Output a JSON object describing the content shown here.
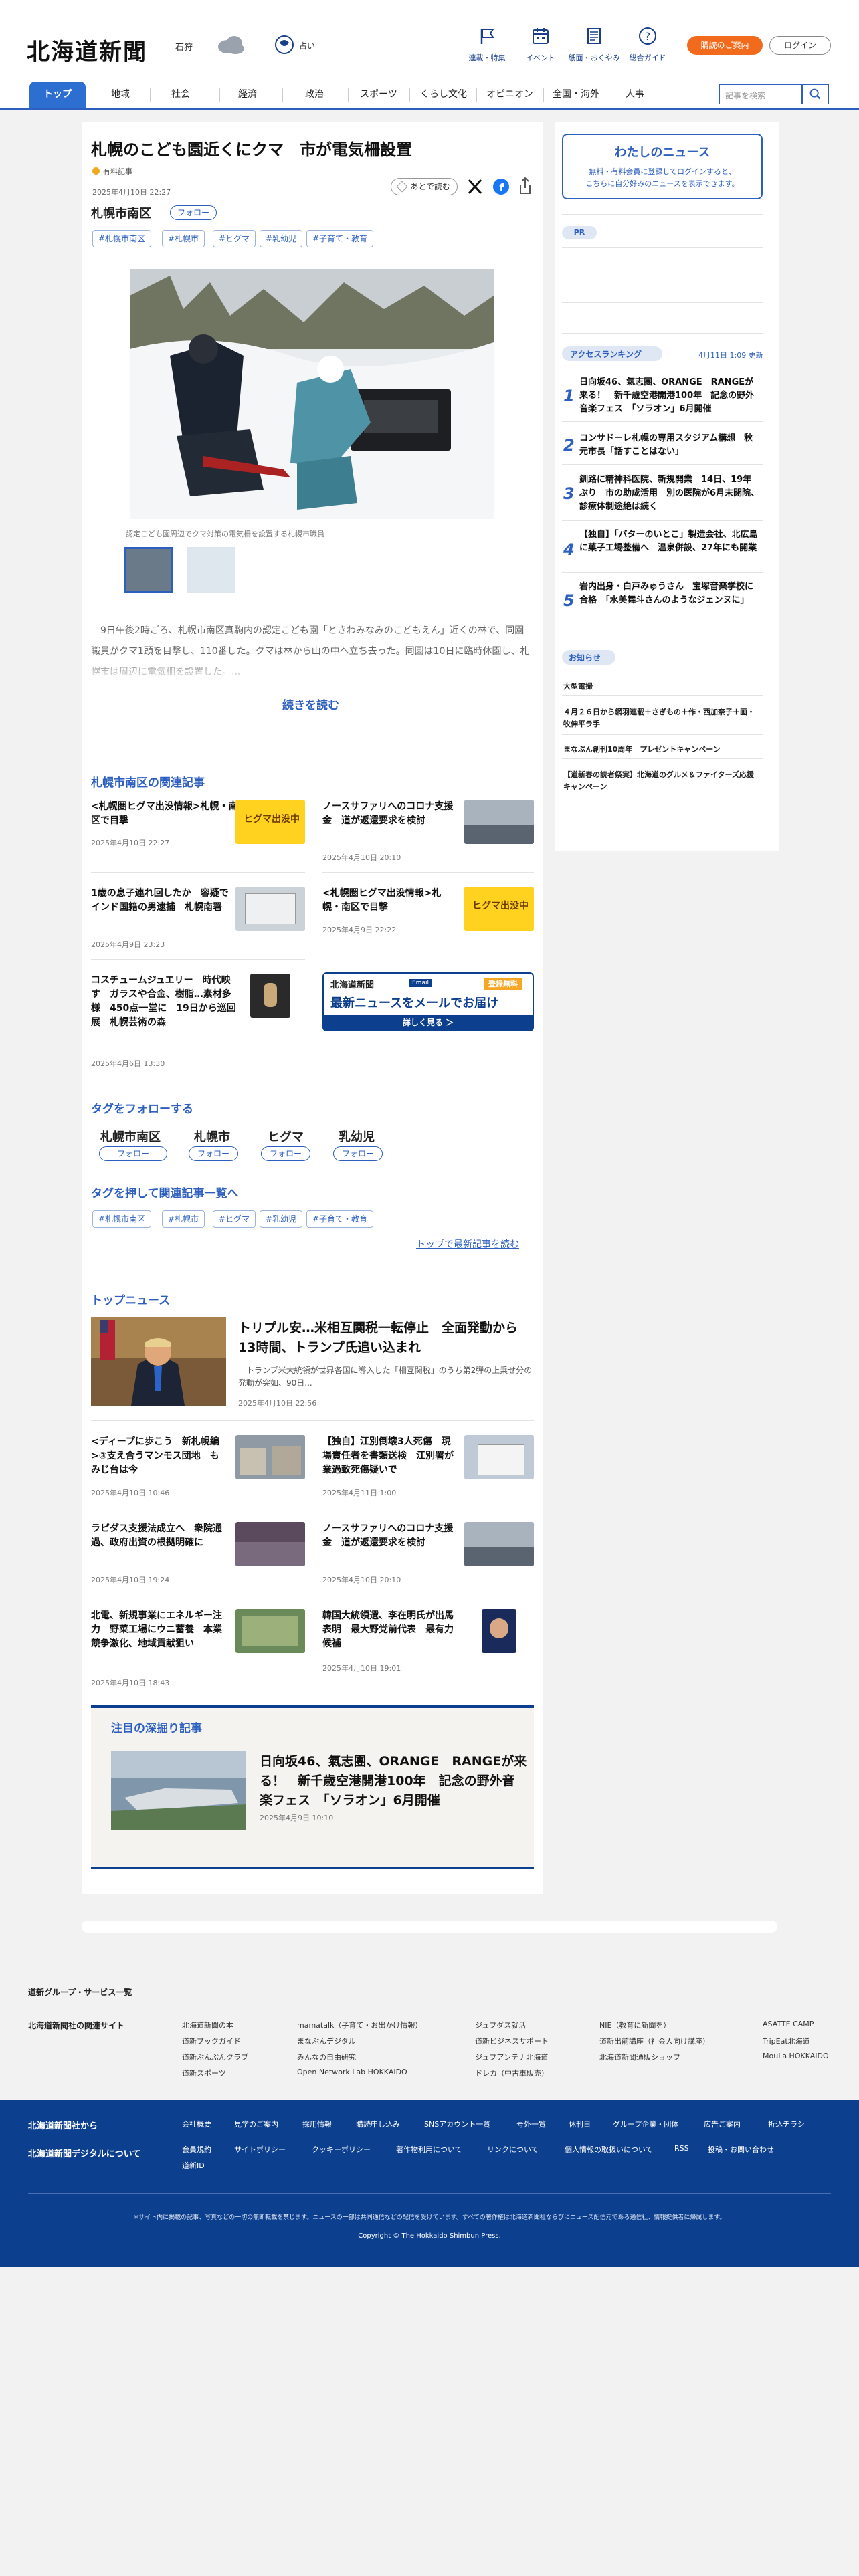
{
  "header": {
    "logo": "北海道新聞",
    "location": "石狩",
    "lang_label": "占い",
    "nav": [
      {
        "label": "連載・特集"
      },
      {
        "label": "イベント"
      },
      {
        "label": "紙面・おくやみ"
      },
      {
        "label": "総合ガイド"
      }
    ],
    "subscribe_label": "購読のご案内",
    "login_label": "ログイン"
  },
  "categories": [
    "トップ",
    "地域",
    "社会",
    "経済",
    "政治",
    "スポーツ",
    "くらし文化",
    "オピニオン",
    "全国・海外",
    "人事"
  ],
  "search": {
    "placeholder": "記事を検索"
  },
  "article": {
    "title": "札幌のこども園近くにクマ　市が電気柵設置",
    "badge": "有料記事",
    "date": "2025年4月10日 22:27",
    "save_label": "あとで読む",
    "area": "札幌市南区",
    "follow_label": "フォロー",
    "tags": [
      "#札幌市南区",
      "#札幌市",
      "#ヒグマ",
      "#乳幼児",
      "#子育て・教育"
    ],
    "caption": "認定こども園周辺でクマ対策の電気柵を設置する札幌市職員",
    "body": "　9日午後2時ごろ、札幌市南区真駒内の認定こども園「ときわみなみのこどもえん」近くの林で、同園職員がクマ1頭を目撃し、110番した。クマは林から山の中へ立ち去った。同園は10日に臨時休園し、札幌市は周辺に電気柵を設置した。...",
    "read_more": "続きを読む"
  },
  "related": {
    "heading": "札幌市南区の関連記事",
    "items": [
      {
        "title": "<札幌圏ヒグマ出没情報>札幌・南区で目撃",
        "date": "2025年4月10日 22:27",
        "thumb_text": "ヒグマ出没中"
      },
      {
        "title": "ノースサファリへのコロナ支援金　道が返還要求を検討",
        "date": "2025年4月10日 20:10",
        "thumb_text": ""
      },
      {
        "title": "1歳の息子連れ回したか　容疑でインド国籍の男逮捕　札幌南署",
        "date": "2025年4月9日 23:23",
        "thumb_text": ""
      },
      {
        "title": "<札幌圏ヒグマ出没情報>札幌・南区で目撃",
        "date": "2025年4月9日 22:22",
        "thumb_text": "ヒグマ出没中"
      },
      {
        "title": "コスチュームジュエリー　時代映す　ガラスや合金、樹脂…素材多様　450点一堂に　19日から巡回展　札幌芸術の森",
        "date": "2025年4月6日 13:30",
        "thumb_text": ""
      }
    ],
    "mail_ad": {
      "logo": "北海道新聞",
      "badge_left": "Email",
      "badge_right": "登録無料",
      "headline": "最新ニュースをメールでお届け",
      "sub": "詳しく見る ＞"
    }
  },
  "follow_tags": {
    "heading": "タグをフォローする",
    "items": [
      "札幌市南区",
      "札幌市",
      "ヒグマ",
      "乳幼児"
    ],
    "button_label": "フォロー"
  },
  "press_tags": {
    "heading": "タグを押して関連記事一覧へ",
    "items": [
      "#札幌市南区",
      "#札幌市",
      "#ヒグマ",
      "#乳幼児",
      "#子育て・教育"
    ],
    "top_link": "トップで最新記事を読む"
  },
  "top_news": {
    "heading": "トップニュース",
    "lead": {
      "title": "トリプル安…米相互関税一転停止　全面発動から13時間、トランプ氏追い込まれ",
      "summary": "　トランプ米大統領が世界各国に導入した「相互関税」のうち第2弾の上乗せ分の発動が突如、90日...",
      "date": "2025年4月10日 22:56"
    },
    "items": [
      {
        "title": "<ディープに歩こう　新札幌編>③支え合うマンモス団地　もみじ台は今",
        "date": "2025年4月10日 10:46"
      },
      {
        "title": "【独自】江別倒壊3人死傷　現場責任者を書類送検　江別署が業過致死傷疑いで",
        "date": "2025年4月11日 1:00"
      },
      {
        "title": "ラピダス支援法成立へ　衆院通過、政府出資の根拠明確に",
        "date": "2025年4月10日 19:24"
      },
      {
        "title": "ノースサファリへのコロナ支援金　道が返還要求を検討",
        "date": "2025年4月10日 20:10"
      },
      {
        "title": "北電、新規事業にエネルギー注力　野菜工場にウニ蓄養　本業競争激化、地域貢献狙い",
        "date": "2025年4月10日 18:43"
      },
      {
        "title": "韓国大統領選、李在明氏が出馬表明　最大野党前代表　最有力候補",
        "date": "2025年4月10日 19:01"
      }
    ]
  },
  "deep": {
    "heading": "注目の深掘り記事",
    "title": "日向坂46、氣志團、ORANGE　RANGEが来る！　新千歳空港開港100年　記念の野外音楽フェス　「ソラオン」6月開催",
    "date": "2025年4月9日 10:10"
  },
  "sidebar": {
    "my_news_title": "わたしのニュース",
    "my_news_text_1": "無料・有料会員に登録して",
    "my_news_login": "ログイン",
    "my_news_text_2": "すると、",
    "my_news_text_3": "こちらに自分好みのニュースを表示できます。",
    "pr_label": "PR",
    "ranking_label": "アクセスランキング",
    "ranking_time": "4月11日 1:09 更新",
    "ranking": [
      {
        "rank": "1",
        "title": "日向坂46、氣志團、ORANGE　RANGEが来る！　新千歳空港開港100年　記念の野外音楽フェス　「ソラオン」6月開催"
      },
      {
        "rank": "2",
        "title": "コンサドーレ札幌の専用スタジアム構想　秋元市長「話すことはない」"
      },
      {
        "rank": "3",
        "title": "釧路に精神科医院、新規開業　14日、19年ぶり　市の助成活用　別の医院が6月末閉院、診療体制途絶は続く"
      },
      {
        "rank": "4",
        "title": "【独自】「バターのいとこ」製造会社、北広島に菓子工場整備へ　温泉併設、27年にも開業"
      },
      {
        "rank": "5",
        "title": "岩内出身・白戸みゅうさん　宝塚音楽学校に合格　「水美舞斗さんのようなジェンヌに」"
      }
    ],
    "notice_label": "お知らせ",
    "notices": [
      "大型電撮",
      "４月２６日から網羽連載＋さぎもの＋作・西加奈子＋画・牧伸平ラ手",
      "まなぶん創刊10周年　プレゼントキャンペーン",
      "【道新春の読者祭実】北海道のグルメ＆ファイターズ応援キャンペーン"
    ]
  },
  "footer": {
    "group_label": "道新グループ・サービス一覧",
    "related_label": "北海道新聞社の関連サイト",
    "links": [
      [
        "北海道新聞の本",
        "道新ブックガイド",
        "道新ぶんぶんクラブ",
        "道新スポーツ"
      ],
      [
        "mamatalk（子育て・お出かけ情報）",
        "まなぶんデジタル",
        "みんなの自由研究",
        "Open Network Lab HOKKAIDO"
      ],
      [
        "ジュプダス就活",
        "道新ビジネスサポート",
        "ジュプアンテナ北海道",
        "ドレカ（中古車販売）"
      ],
      [
        "NIE（教育に新聞を）",
        "道新出前講座（社会人向け講座）",
        "北海道新聞通販ショップ"
      ],
      [
        "ASATTE CAMP",
        "TripEat北海道",
        "MouLa HOKKAIDO"
      ]
    ],
    "company_label": "北海道新聞社から",
    "digital_label": "北海道新聞デジタルについて",
    "company_links": [
      "会社概要",
      "見学のご案内",
      "採用情報",
      "購読申し込み",
      "SNSアカウント一覧",
      "号外一覧",
      "休刊日",
      "グループ企業・団体",
      "広告ご案内",
      "折込チラシ"
    ],
    "digital_links": [
      "会員規約",
      "サイトポリシー",
      "クッキーポリシー",
      "著作物利用について",
      "リンクについて",
      "個人情報の取扱いについて",
      "RSS",
      "投稿・お問い合わせ",
      "道新ID"
    ],
    "notice": "※サイト内に掲載の記事、写真などの一切の無断転載を禁じます。ニュースの一部は共同通信などの配信を受けています。すべての著作権は北海道新聞社ならびにニュース配信元である通信社、情報提供者に帰属します。",
    "copyright": "Copyright © The Hokkaido Shimbun Press."
  },
  "colors": {
    "brand_blue": "#2c5fbf",
    "footer_blue": "#0d3f8f",
    "orange": "#f26b1d"
  }
}
